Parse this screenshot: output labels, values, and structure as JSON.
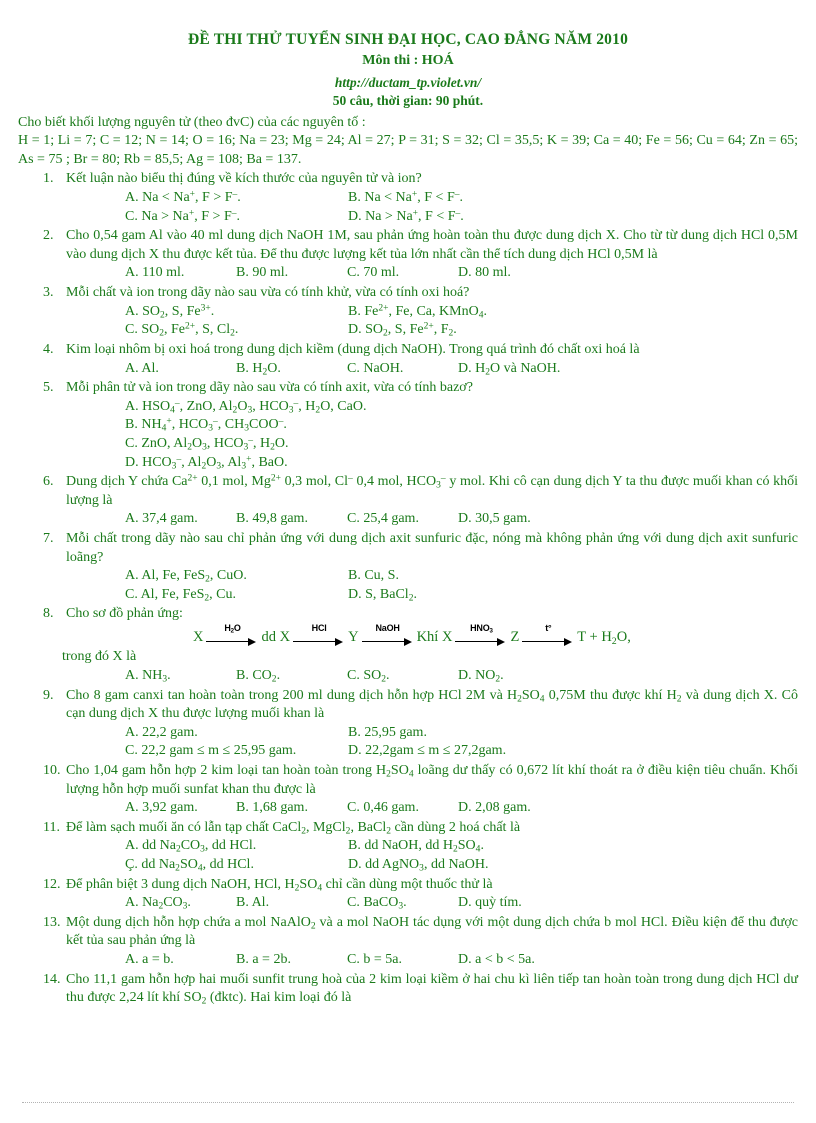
{
  "header": {
    "title": "ĐỀ THI THỬ TUYỂN SINH ĐẠI HỌC, CAO ĐẲNG NĂM 2010",
    "subject": "Môn thi : HOÁ",
    "url": "http://ductam_tp.violet.vn/",
    "meta": "50 câu, thời gian: 90 phút."
  },
  "preamble": {
    "line1": "Cho biết khối lượng nguyên tử (theo đvC) của các nguyên tố :",
    "line2": "H = 1; Li = 7; C = 12; N = 14; O = 16; Na = 23; Mg = 24; Al = 27; P = 31; S = 32; Cl = 35,5; K = 39; Ca = 40; Fe = 56; Cu = 64; Zn = 65; As = 75 ; Br = 80; Rb = 85,5; Ag = 108; Ba = 137."
  },
  "questions": [
    {
      "num": "1.",
      "text": "Kết luận nào biểu thị đúng về kích thước của nguyên tử và ion?",
      "layout": "cols2",
      "options": [
        "A. Na < Na<sup>+</sup>, F > F<sup>–</sup>.",
        "B. Na < Na<sup>+</sup>, F < F<sup>–</sup>.",
        "C. Na > Na<sup>+</sup>, F > F<sup>–</sup>.",
        "D. Na > Na<sup>+</sup>, F < F<sup>–</sup>."
      ]
    },
    {
      "num": "2.",
      "text": "Cho 0,54 gam Al vào 40 ml dung dịch NaOH 1M, sau phản ứng hoàn toàn thu được dung dịch X. Cho từ từ dung dịch HCl 0,5M vào dung dịch X thu được kết tủa. Để thu được lượng kết tủa lớn nhất cần thể tích dung dịch HCl 0,5M là",
      "layout": "cols4",
      "options": [
        "A. 110 ml.",
        "B. 90 ml.",
        "C. 70 ml.",
        "D. 80 ml."
      ]
    },
    {
      "num": "3.",
      "text": "Mỗi chất và ion trong dãy nào sau vừa có tính khử, vừa có tính oxi hoá?",
      "layout": "cols2",
      "options": [
        "A. SO<sub>2</sub>, S, Fe<sup>3+</sup>.",
        "B. Fe<sup>2+</sup>, Fe, Ca, KMnO<sub>4</sub>.",
        "C. SO<sub>2</sub>, Fe<sup>2+</sup>, S, Cl<sub>2</sub>.",
        "D. SO<sub>2</sub>, S, Fe<sup>2+</sup>, F<sub>2</sub>."
      ]
    },
    {
      "num": "4.",
      "text": "Kim loại nhôm bị oxi hoá trong dung dịch kiềm (dung dịch NaOH). Trong quá trình đó chất oxi hoá là",
      "layout": "cols4",
      "options": [
        "A. Al.",
        "B. H<sub>2</sub>O.",
        "C. NaOH.",
        "D. H<sub>2</sub>O và NaOH."
      ]
    },
    {
      "num": "5.",
      "text": "Mỗi phân tử và ion trong dãy nào sau vừa có tính axit, vừa có tính bazơ?",
      "layout": "stack",
      "options": [
        "A. HSO<sub>4</sub><sup>–</sup>, ZnO, Al<sub>2</sub>O<sub>3</sub>, HCO<sub>3</sub><sup>–</sup>, H<sub>2</sub>O, CaO.",
        "B. NH<sub>4</sub><sup>+</sup>, HCO<sub>3</sub><sup>–</sup>, CH<sub>3</sub>COO<sup>–</sup>.",
        "C. ZnO, Al<sub>2</sub>O<sub>3</sub>, HCO<sub>3</sub><sup>–</sup>, H<sub>2</sub>O.",
        "D. HCO<sub>3</sub><sup>–</sup>, Al<sub>2</sub>O<sub>3</sub>, Al<sub>3</sub><sup>+</sup>, BaO."
      ]
    },
    {
      "num": "6.",
      "text": "Dung dịch Y chứa Ca<sup>2+</sup> 0,1 mol, Mg<sup>2+</sup> 0,3 mol, Cl<sup>–</sup> 0,4 mol, HCO<sub>3</sub><sup>–</sup> y mol. Khi cô cạn dung dịch Y ta thu được muối khan có khối lượng là",
      "layout": "cols4",
      "options": [
        "A. 37,4 gam.",
        "B. 49,8 gam.",
        "C. 25,4 gam.",
        "D. 30,5 gam."
      ]
    },
    {
      "num": "7.",
      "text": "Mỗi chất trong dãy nào sau chỉ phản ứng với dung dịch axit sunfuric đặc, nóng mà không phản ứng với dung dịch axit sunfuric loãng?",
      "layout": "cols2",
      "options": [
        "A. Al, Fe, FeS<sub>2</sub>, CuO.",
        "B. Cu, S.",
        "C. Al, Fe, FeS<sub>2</sub>, Cu.",
        "D. S, BaCl<sub>2</sub>."
      ]
    },
    {
      "num": "8.",
      "text": "Cho sơ đồ phản ứng:",
      "layout": "cols4",
      "scheme": {
        "nodes": [
          "X",
          "dd X",
          "Y",
          "Khí X",
          "Z",
          "T + H<sub>2</sub>O,"
        ],
        "arrow_labels": [
          "H<sub>2</sub>O",
          "HCl",
          "NaOH",
          "HNO<sub>3</sub>",
          "t°"
        ]
      },
      "continuation": "trong đó X là",
      "options": [
        "A. NH<sub>3</sub>.",
        "B. CO<sub>2</sub>.",
        "C. SO<sub>2</sub>.",
        "D. NO<sub>2</sub>."
      ]
    },
    {
      "num": "9.",
      "text": "Cho 8 gam canxi tan hoàn toàn trong 200 ml dung dịch hỗn hợp HCl 2M và H<sub>2</sub>SO<sub>4</sub> 0,75M thu được khí H<sub>2</sub> và dung dịch X. Cô cạn dung dịch X thu được lượng muối khan là",
      "layout": "cols2",
      "options": [
        "A. 22,2 gam.",
        "B. 25,95 gam.",
        "C. 22,2 gam ≤ m ≤ 25,95 gam.",
        "D. 22,2gam ≤ m ≤ 27,2gam."
      ]
    },
    {
      "num": "10.",
      "text": "Cho 1,04 gam hỗn hợp 2 kim loại tan hoàn toàn trong H<sub>2</sub>SO<sub>4</sub> loãng dư thấy có 0,672 lít khí thoát ra ở điều kiện tiêu chuẩn. Khối lượng hỗn hợp muối sunfat khan thu được là",
      "layout": "cols4",
      "options": [
        "A. 3,92 gam.",
        "B. 1,68 gam.",
        "C. 0,46 gam.",
        "D. 2,08 gam."
      ]
    },
    {
      "num": "11.",
      "text": "Để làm sạch muối ăn có lẫn tạp chất CaCl<sub>2</sub>, MgCl<sub>2</sub>, BaCl<sub>2</sub> cần dùng 2 hoá chất là",
      "layout": "cols2",
      "options": [
        "A. dd Na<sub>2</sub>CO<sub>3</sub>, dd HCl.",
        "B. dd NaOH, dd H<sub>2</sub>SO<sub>4</sub>.",
        "Ç. dd Na<sub>2</sub>SO<sub>4</sub>, dd HCl.",
        "D. dd AgNO<sub>3</sub>, dd NaOH."
      ]
    },
    {
      "num": "12.",
      "text": "Để phân biệt 3 dung dịch NaOH, HCl, H<sub>2</sub>SO<sub>4</sub> chỉ cần dùng một thuốc thử là",
      "layout": "cols4",
      "options": [
        "A. Na<sub>2</sub>CO<sub>3</sub>.",
        "B. Al.",
        "C. BaCO<sub>3</sub>.",
        "D. quỳ tím."
      ]
    },
    {
      "num": "13.",
      "text": "Một dung dịch hỗn hợp chứa a mol NaAlO<sub>2</sub> và a mol NaOH tác dụng với một dung dịch chứa b mol HCl. Điều kiện để thu được kết tủa sau phản ứng là",
      "layout": "cols4",
      "options": [
        "A. a = b.",
        "B. a = 2b.",
        "C. b = 5a.",
        "D. a < b < 5a."
      ]
    },
    {
      "num": "14.",
      "text": "Cho 11,1 gam hỗn hợp hai muối sunfit trung hoà của 2 kim loại kiềm ở hai chu kì liên tiếp tan hoàn toàn trong dung dịch HCl dư thu được 2,24 lít khí SO<sub>2</sub> (đktc). Hai kim loại đó là",
      "layout": "none",
      "options": []
    }
  ],
  "colors": {
    "text": "#1a7a1a",
    "arrow": "#000000",
    "background": "#ffffff"
  }
}
